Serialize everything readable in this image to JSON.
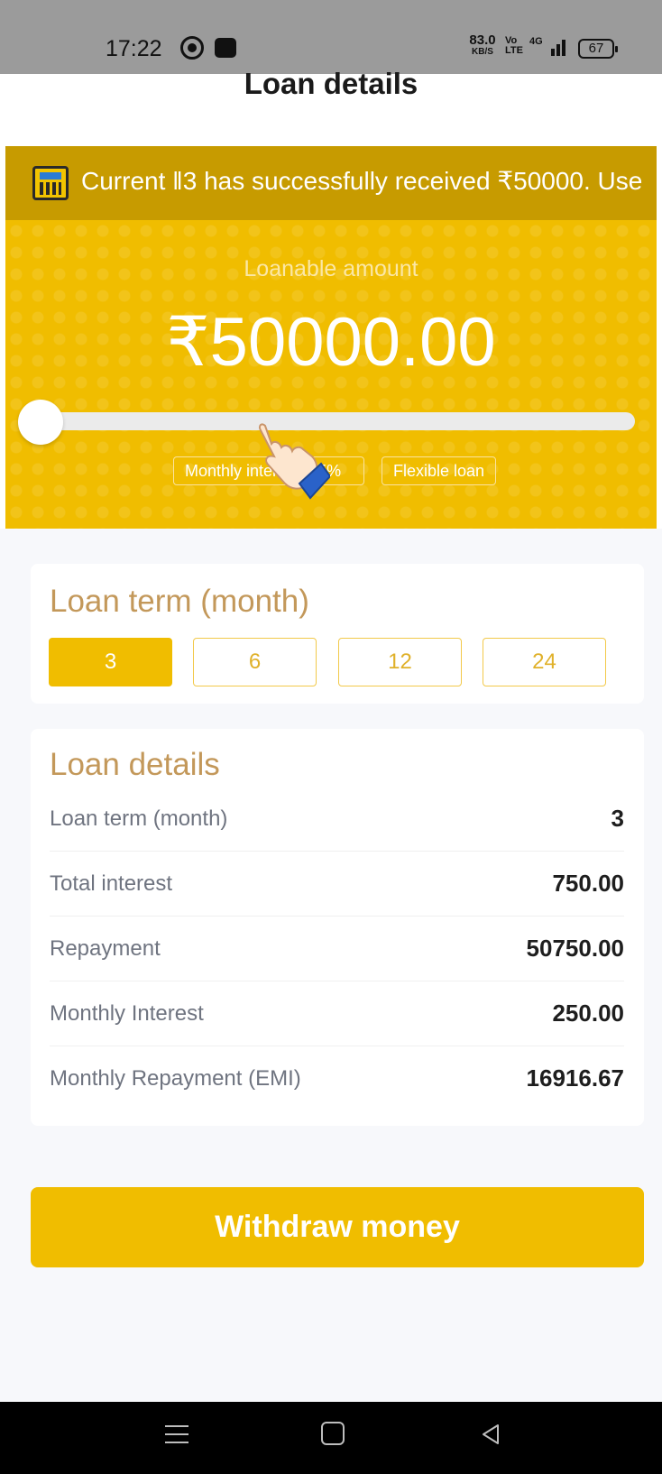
{
  "status_bar": {
    "time": "17:22",
    "net_speed_value": "83.0",
    "net_speed_unit": "KB/S",
    "network_volte": "Vo",
    "network_lte": "LTE",
    "network_type": "4G",
    "battery": "67",
    "icons": [
      "whatsapp-icon",
      "app-notification-icon",
      "signal-icon",
      "battery-icon"
    ]
  },
  "header": {
    "title": "Loan details"
  },
  "ticker": {
    "text": "Current ‖3 has successfully received ₹50000. Use",
    "icon": "calculator-icon"
  },
  "hero": {
    "label": "Loanable amount",
    "amount": "₹50000.00",
    "slider_value_fraction": 0.0,
    "tags": {
      "interest": "Monthly interest 0.5%",
      "flexible": "Flexible loan"
    }
  },
  "term_card": {
    "title": "Loan term (month)",
    "options": [
      "3",
      "6",
      "12",
      "24"
    ],
    "selected": "3"
  },
  "details_card": {
    "title": "Loan details",
    "rows": [
      {
        "label": "Loan term (month)",
        "value": "3"
      },
      {
        "label": "Total interest",
        "value": "750.00"
      },
      {
        "label": "Repayment",
        "value": "50750.00"
      },
      {
        "label": "Monthly Interest",
        "value": "250.00"
      },
      {
        "label": "Monthly Repayment (EMI)",
        "value": "16916.67"
      }
    ]
  },
  "action": {
    "withdraw_label": "Withdraw money"
  },
  "colors": {
    "primary": "#f0bd00",
    "ticker_bg": "#c79b00",
    "card_title": "#c3985a",
    "status_bar_bg": "#9b9b9b"
  }
}
